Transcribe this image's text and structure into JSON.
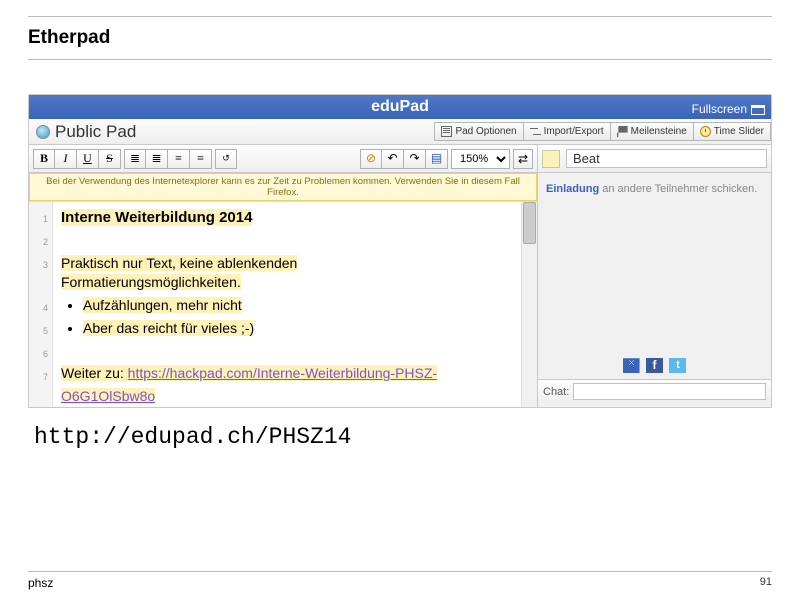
{
  "slide": {
    "title": "Etherpad",
    "url": "http://edupad.ch/PHSZ14",
    "footer": "phsz",
    "page": "91"
  },
  "app": {
    "name": "eduPad",
    "fullscreen": "Fullscreen",
    "pad_title": "Public Pad",
    "btns": {
      "opt": "Pad Optionen",
      "imp": "Import/Export",
      "mile": "Meilensteine",
      "slider": "Time Slider"
    },
    "fmt": {
      "bold": "B",
      "italic": "I",
      "underline": "U",
      "strike": "S",
      "ul": "≣",
      "ol": "≣",
      "ind": "≡",
      "out": "≡",
      "clr": "⎌"
    },
    "zoom": "150%",
    "warn": "Bei der Verwendung des Internetexplorer kann es zur Zeit zu Problemen kommen. Verwenden Sie in diesem Fall Firefox.",
    "lines": [
      "1",
      "2",
      "3",
      "",
      "4",
      "5",
      "6",
      "7"
    ],
    "doc": {
      "h": "Interne Weiterbildung 2014",
      "p1a": "Praktisch nur Text, keine ablenkenden",
      "p1b": "Formatierungsmöglichkeiten.",
      "li1": "Aufzählungen, mehr nicht",
      "li2": "Aber das reicht für vieles ;-)",
      "p2": "Weiter zu: ",
      "link": "https://hackpad.com/Interne-Weiterbildung-PHSZ-O6G1OlSbw8o"
    },
    "user": "Beat",
    "invite_b": "Einladung",
    "invite_t": " an andere Teilnehmer schicken.",
    "chat": "Chat:"
  }
}
